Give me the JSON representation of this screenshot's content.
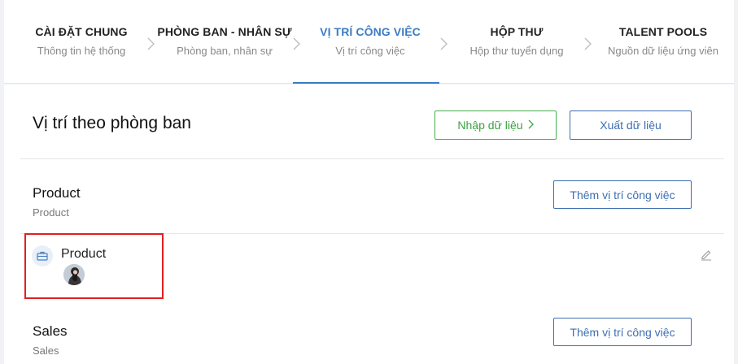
{
  "steps": [
    {
      "title": "CÀI ĐẶT CHUNG",
      "sub": "Thông tin hệ thống"
    },
    {
      "title": "PHÒNG BAN - NHÂN SỰ",
      "sub": "Phòng ban, nhân sự"
    },
    {
      "title": "VỊ TRÍ CÔNG VIỆC",
      "sub": "Vị trí công việc",
      "active": true
    },
    {
      "title": "HỘP THƯ",
      "sub": "Hộp thư tuyển dụng"
    },
    {
      "title": "TALENT POOLS",
      "sub": "Nguồn dữ liệu ứng viên"
    }
  ],
  "page": {
    "title": "Vị trí theo phòng ban",
    "import_label": "Nhập dữ liệu",
    "export_label": "Xuất dữ liệu"
  },
  "departments": [
    {
      "name": "Product",
      "sub": "Product",
      "add_label": "Thêm vị trí công việc",
      "jobs": [
        {
          "title": "Product"
        }
      ]
    },
    {
      "name": "Sales",
      "sub": "Sales",
      "add_label": "Thêm vị trí công việc"
    }
  ],
  "colors": {
    "accent": "#3d7bc4",
    "import_green": "#48b14f",
    "highlight_red": "#e02020"
  },
  "icons": {
    "step_separator": "chevron-right-icon",
    "job": "briefcase-icon",
    "edit": "pencil-icon",
    "import_arrow": "chevron-right-icon"
  }
}
